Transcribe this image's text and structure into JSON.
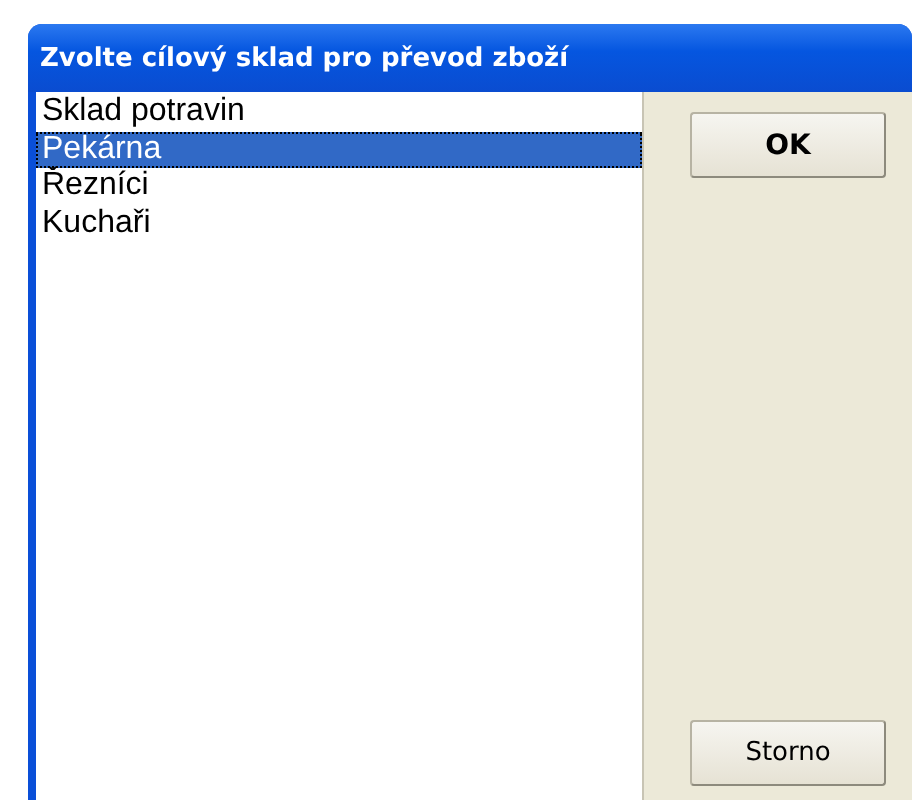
{
  "window": {
    "title": "Zvolte cílový sklad pro převod zboží"
  },
  "list": {
    "items": [
      {
        "label": "Sklad potravin",
        "selected": false
      },
      {
        "label": "Pekárna",
        "selected": true
      },
      {
        "label": "Řezníci",
        "selected": false
      },
      {
        "label": "Kuchaři",
        "selected": false
      }
    ]
  },
  "buttons": [
    {
      "label": "OK",
      "kind": "default"
    },
    {
      "label": "Storno",
      "kind": "normal"
    }
  ]
}
